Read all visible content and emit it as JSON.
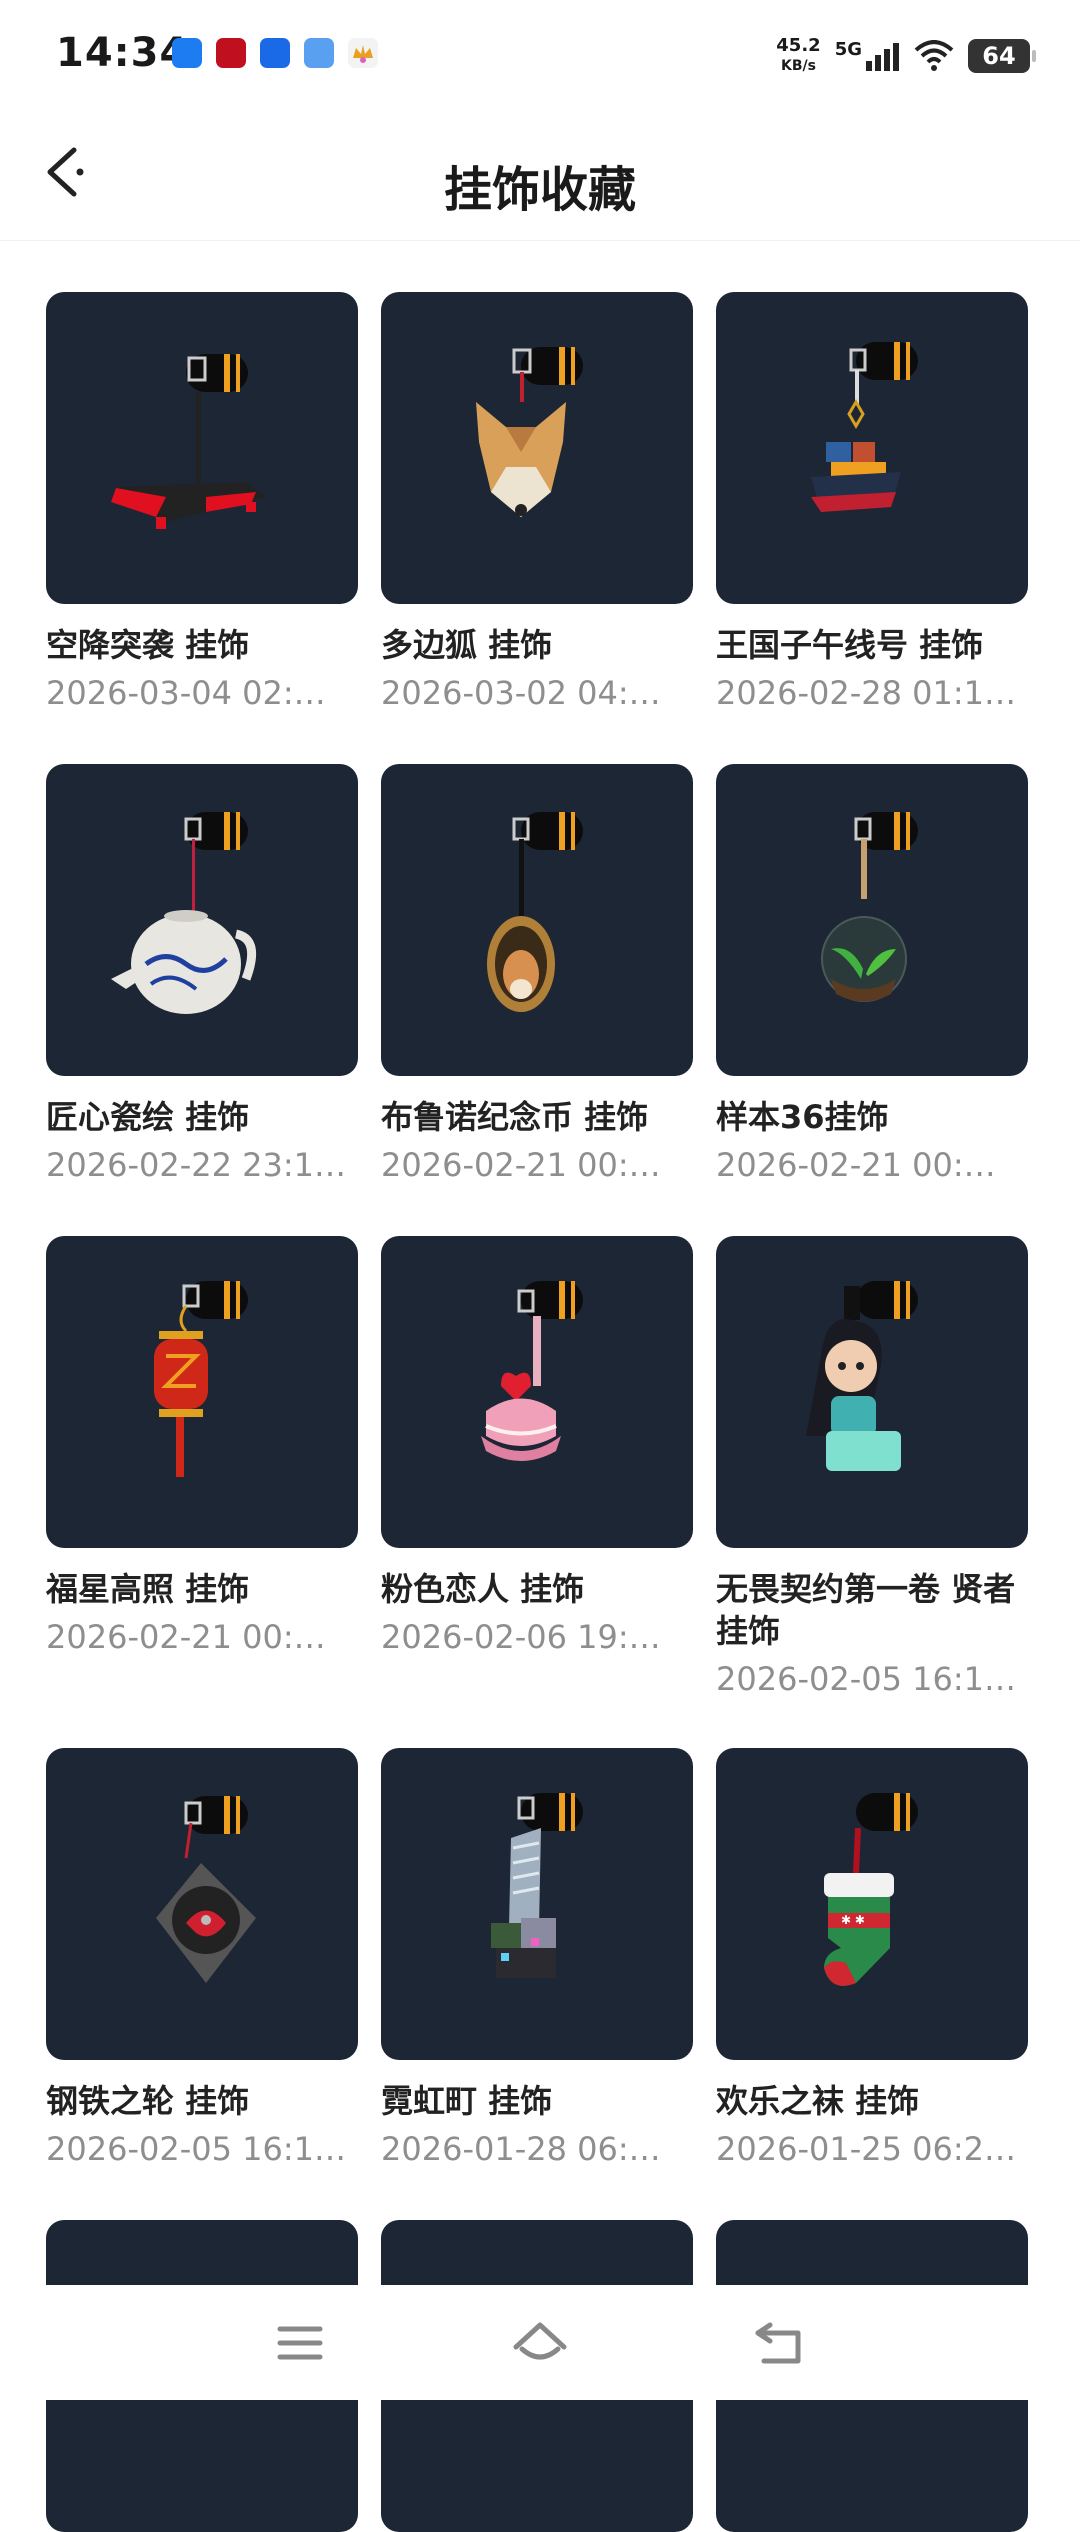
{
  "status_bar": {
    "time": "14:34",
    "net_speed_value": "45.2",
    "net_speed_unit": "KB/s",
    "network": "5G",
    "battery": "64",
    "app_icon_colors": [
      "#1e7cf2",
      "#c01020",
      "#1a6ae8",
      "#5aa0f0",
      "#e8a020"
    ]
  },
  "header": {
    "title": "挂饰收藏"
  },
  "colors": {
    "card_bg": "#1c2635",
    "accent_orange": "#f0a020"
  },
  "items": [
    {
      "name": "空降突袭 挂饰",
      "date": "2026-03-04 02:…",
      "icon": "drone-charm-icon"
    },
    {
      "name": "多边狐 挂饰",
      "date": "2026-03-02 04:…",
      "icon": "fox-charm-icon"
    },
    {
      "name": "王国子午线号 挂饰",
      "date": "2026-02-28 01:1…",
      "icon": "ship-charm-icon"
    },
    {
      "name": "匠心瓷绘 挂饰",
      "date": "2026-02-22 23:1…",
      "icon": "teapot-charm-icon"
    },
    {
      "name": "布鲁诺纪念币 挂饰",
      "date": "2026-02-21 00:…",
      "icon": "coin-charm-icon"
    },
    {
      "name": "样本36挂饰",
      "date": "2026-02-21 00:…",
      "icon": "terrarium-charm-icon"
    },
    {
      "name": "福星高照 挂饰",
      "date": "2026-02-21 00:…",
      "icon": "lantern-charm-icon"
    },
    {
      "name": "粉色恋人 挂饰",
      "date": "2026-02-06 19:…",
      "icon": "cake-charm-icon"
    },
    {
      "name": "无畏契约第一卷 贤者 挂饰",
      "date": "2026-02-05 16:1…",
      "icon": "sage-charm-icon"
    },
    {
      "name": "钢铁之轮 挂饰",
      "date": "2026-02-05 16:1…",
      "icon": "turntable-charm-icon"
    },
    {
      "name": "霓虹町 挂饰",
      "date": "2026-01-28 06:…",
      "icon": "building-charm-icon"
    },
    {
      "name": "欢乐之袜 挂饰",
      "date": "2026-01-25 06:2…",
      "icon": "stocking-charm-icon"
    }
  ],
  "navigation": {
    "menu_icon": "menu-icon",
    "home_icon": "home-icon",
    "back_icon": "back-nav-icon"
  }
}
